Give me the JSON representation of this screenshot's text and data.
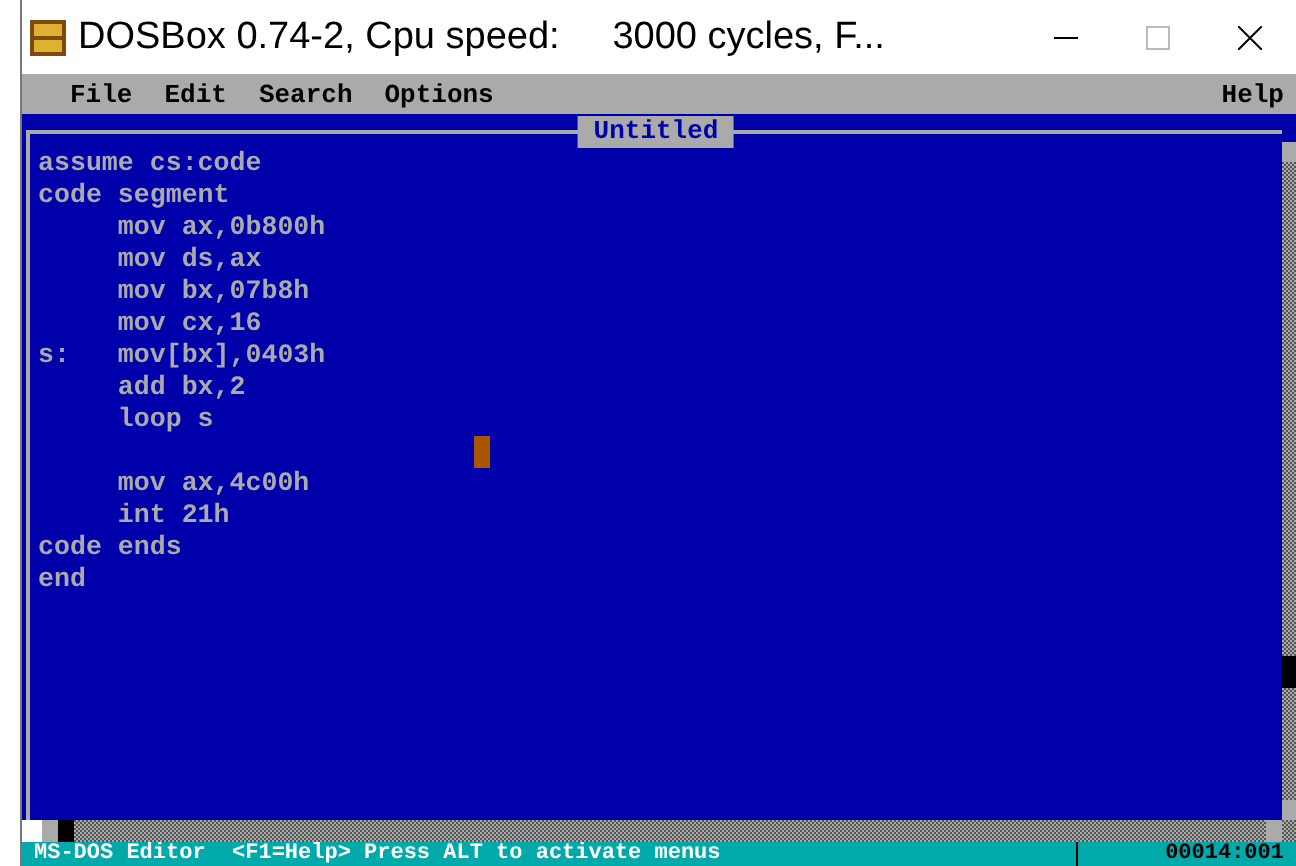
{
  "window": {
    "title": "DOSBox 0.74-2, Cpu speed:     3000 cycles, F..."
  },
  "menu": {
    "left_items": [
      "File",
      "Edit",
      "Search",
      "Options"
    ],
    "right_items": [
      "Help"
    ]
  },
  "editor": {
    "title": "Untitled",
    "paragraphs": [
      [
        "assume cs:code",
        "code segment",
        "     mov ax,0b800h",
        "     mov ds,ax",
        "     mov bx,07b8h",
        "     mov cx,16",
        "s:   mov[bx],0403h",
        "     add bx,2",
        "     loop s"
      ],
      [
        "     mov ax,4c00h",
        "     int 21h",
        "code ends",
        "end"
      ]
    ]
  },
  "status_bar": {
    "message": "MS-DOS Editor  <F1=Help> Press ALT to activate menus",
    "position": "00014:001"
  }
}
